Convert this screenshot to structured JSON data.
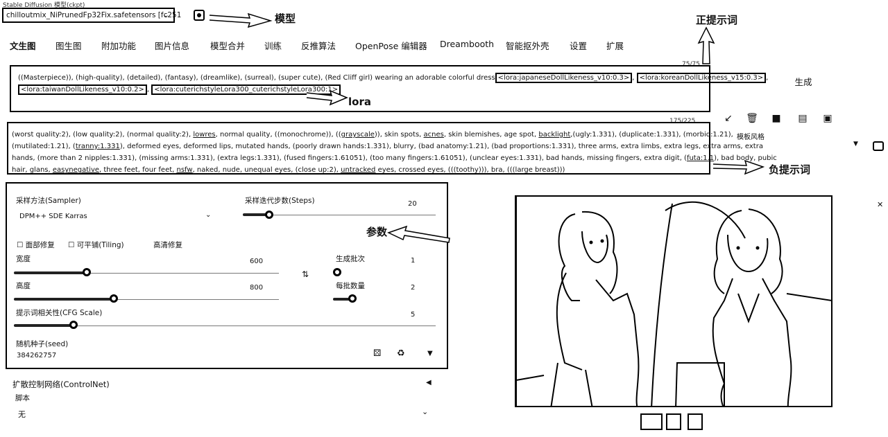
{
  "model": {
    "label": "Stable Diffusion 模型(ckpt)",
    "selected": "chilloutmix_NiPrunedFp32Fix.safetensors [fc251"
  },
  "annotations": {
    "model": "模型",
    "positive": "正提示词",
    "lora": "lora",
    "negative": "负提示词",
    "params": "参数"
  },
  "tabs": [
    "文生图",
    "图生图",
    "附加功能",
    "图片信息",
    "模型合并",
    "训练",
    "反推算法",
    "OpenPose 编辑器",
    "Dreambooth",
    "智能抠外壳",
    "设置",
    "扩展"
  ],
  "positive_prompt": {
    "counter": "75/75",
    "line1": "((Masterpiece)), (high-quality), (detailed), (fantasy), (dreamlike), (surreal), (super cute), (Red Cliff girl) wearing an adorable colorful dress",
    "lora1": "<lora:japaneseDollLikeness_v10:0.3>",
    "lora2": "<lora:koreanDollLikeness_v15:0.3>",
    "lora3": "<lora:taiwanDollLikeness_v10:0.2>",
    "lora4": "<lora:cuterichstyleLora300_cuterichstyleLora300:1>",
    "sep": ", "
  },
  "negative_prompt": {
    "counter": "175/225",
    "l1a": "(worst quality:2), (low quality:2), (normal quality:2), ",
    "lowres": "lowres",
    "l1b": ", normal quality, ((monochrome)), ((",
    "grayscale": "grayscale",
    "l1c": ")), skin spots, ",
    "acnes": "acnes",
    "l1d": ", skin blemishes, age spot, ",
    "backlight": "backlight",
    "l1e": ",(ugly:1.331), (duplicate:1.331), (morbid:1.21),",
    "l2a": "(mutilated:1.21), (",
    "tranny": "tranny:1.331",
    "l2b": "), deformed eyes, deformed lips, mutated hands, (poorly drawn hands:1.331), blurry, (bad anatomy:1.21), (bad proportions:1.331), three arms, extra limbs, extra legs, extra arms, extra",
    "l3a": "hands, (more than 2 nipples:1.331), (missing arms:1.331), (extra legs:1.331), (fused fingers:1.61051), (too many fingers:1.61051), (unclear eyes:1.331), bad hands, missing fingers, extra digit, (",
    "futa": "futa:1.1",
    "l3b": "), bad body, pubic",
    "l4a": "hair, glans, ",
    "easynegative": "easynegative",
    "l4b": ", three feet, four feet, ",
    "nsfw": "nsfw",
    "l4c": ", naked, nude, unequal eyes, (close up:2), ",
    "untracked": "untracked",
    "l4d": " eyes, crossed eyes, (((toothy))), bra, (((large breast)))"
  },
  "toolbar": {
    "generate": "生成",
    "style_label": "模板风格"
  },
  "params": {
    "sampler_label": "采样方法(Sampler)",
    "sampler_value": "DPM++ SDE Karras",
    "steps_label": "采样迭代步数(Steps)",
    "steps_value": "20",
    "steps_fraction": 0.13,
    "face_restore": "面部修复",
    "tiling": "可平铺(Tiling)",
    "hires": "高清修复",
    "width_label": "宽度",
    "width_value": "600",
    "height_label": "高度",
    "height_value": "800",
    "batch_count_label": "生成批次",
    "batch_count_value": "1",
    "batch_size_label": "每批数量",
    "batch_size_value": "2",
    "cfg_label": "提示词相关性(CFG Scale)",
    "cfg_value": "5",
    "seed_label": "随机种子(seed)",
    "seed_value": "384262757"
  },
  "controlnet": {
    "label": "扩散控制网络(ControlNet)",
    "script_label": "脚本",
    "script_value": "无"
  }
}
